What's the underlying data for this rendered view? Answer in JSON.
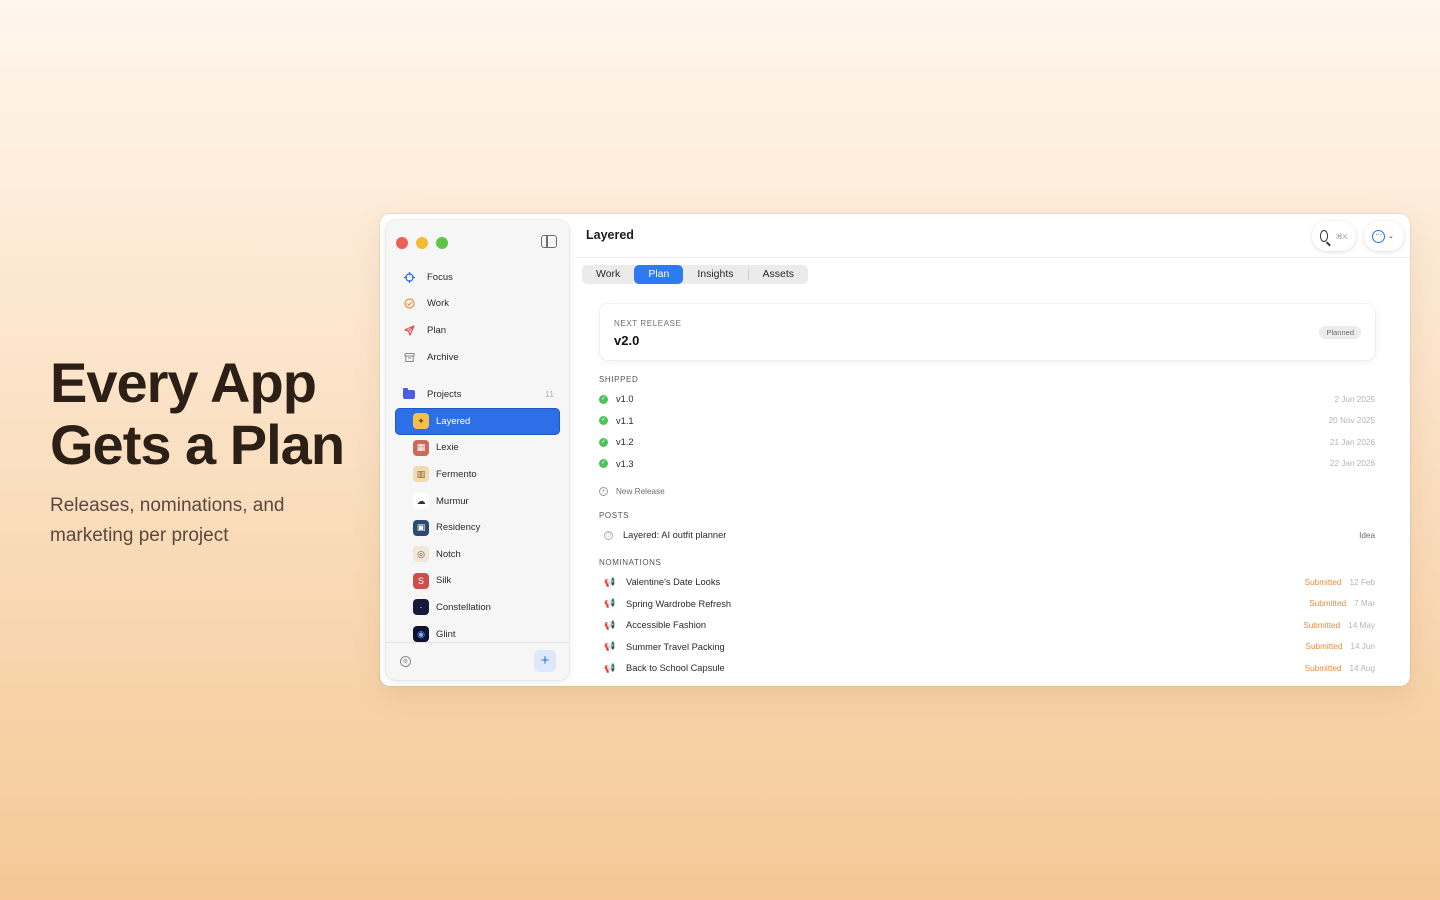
{
  "hero": {
    "title": "Every App\nGets a Plan",
    "subtitle": "Releases, nominations, and marketing per project"
  },
  "sidebar": {
    "nav": [
      {
        "label": "Focus",
        "icon": "crosshair-icon",
        "color": "#2c6fe6"
      },
      {
        "label": "Work",
        "icon": "check-circle-icon",
        "color": "#ee8a3c"
      },
      {
        "label": "Plan",
        "icon": "paper-plane-icon",
        "color": "#e0454a"
      },
      {
        "label": "Archive",
        "icon": "archive-box-icon",
        "color": "#8a8a8a"
      }
    ],
    "projects_label": "Projects",
    "projects_count": "11",
    "projects": [
      {
        "label": "Layered",
        "color": "#f5c04a",
        "glyph": "✦"
      },
      {
        "label": "Lexie",
        "color": "#c86a5c",
        "glyph": "▦"
      },
      {
        "label": "Fermento",
        "color": "#f3d9b0",
        "glyph": "▥"
      },
      {
        "label": "Murmur",
        "color": "#ffffff",
        "glyph": "☁"
      },
      {
        "label": "Residency",
        "color": "#2e4b6e",
        "glyph": "▣"
      },
      {
        "label": "Notch",
        "color": "#f1e6d8",
        "glyph": "◎"
      },
      {
        "label": "Silk",
        "color": "#c9504c",
        "glyph": "S"
      },
      {
        "label": "Constellation",
        "color": "#141b3a",
        "glyph": "·"
      },
      {
        "label": "Glint",
        "color": "#0d1430",
        "glyph": "◉"
      }
    ],
    "add_label": "+"
  },
  "titlebar": {
    "title": "Layered",
    "search_shortcut": "⌘K"
  },
  "tabs": [
    {
      "label": "Work",
      "active": false
    },
    {
      "label": "Plan",
      "active": true
    },
    {
      "label": "Insights",
      "active": false
    },
    {
      "label": "Assets",
      "active": false
    }
  ],
  "next_release": {
    "label": "NEXT RELEASE",
    "version": "v2.0",
    "status": "Planned"
  },
  "shipped": {
    "label": "SHIPPED",
    "items": [
      {
        "version": "v1.0",
        "date": "2 Jun 2025"
      },
      {
        "version": "v1.1",
        "date": "20 Nov 2025"
      },
      {
        "version": "v1.2",
        "date": "21 Jan 2026"
      },
      {
        "version": "v1.3",
        "date": "22 Jan 2026"
      }
    ],
    "new_release_label": "New Release"
  },
  "posts": {
    "label": "POSTS",
    "items": [
      {
        "title": "Layered: AI outfit planner",
        "status": "Idea"
      }
    ]
  },
  "nominations": {
    "label": "NOMINATIONS",
    "items": [
      {
        "title": "Valentine's Date Looks",
        "status": "Submitted",
        "date": "12 Feb"
      },
      {
        "title": "Spring Wardrobe Refresh",
        "status": "Submitted",
        "date": "7 Mar"
      },
      {
        "title": "Accessible Fashion",
        "status": "Submitted",
        "date": "14 May"
      },
      {
        "title": "Summer Travel Packing",
        "status": "Submitted",
        "date": "14 Jun"
      },
      {
        "title": "Back to School Capsule",
        "status": "Submitted",
        "date": "14 Aug"
      }
    ]
  }
}
